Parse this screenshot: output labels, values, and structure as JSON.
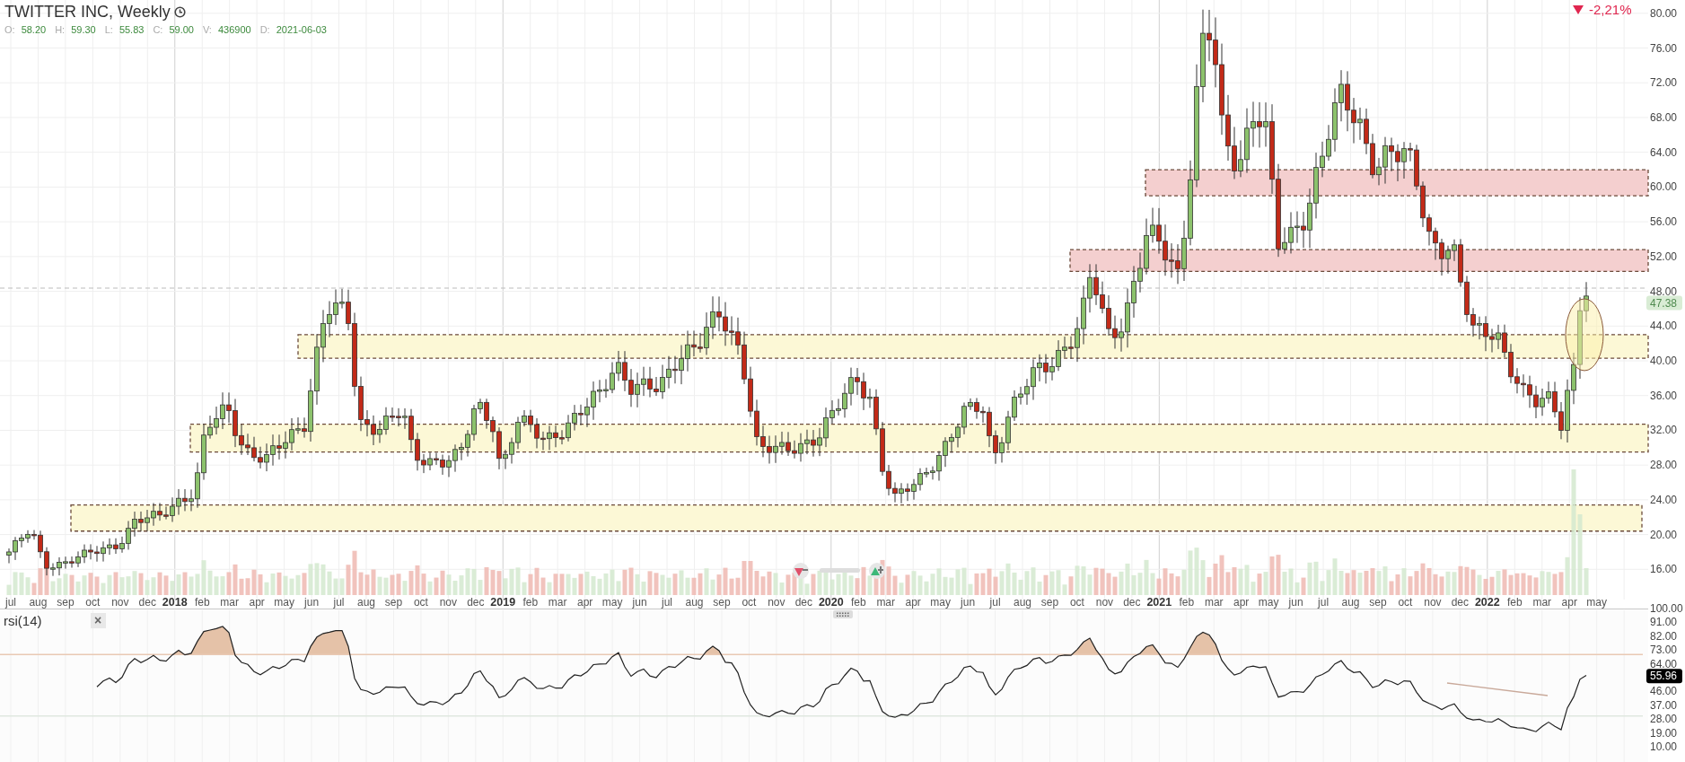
{
  "header": {
    "title": "TWITTER INC, Weekly",
    "fields": [
      {
        "label": "O:",
        "value": "58.20"
      },
      {
        "label": "H:",
        "value": "59.30"
      },
      {
        "label": "L:",
        "value": "55.83"
      },
      {
        "label": "C:",
        "value": "59.00"
      },
      {
        "label": "V:",
        "value": "436900"
      },
      {
        "label": "D:",
        "value": "2021-06-03"
      }
    ]
  },
  "change": {
    "text": "-2,21%",
    "falling": true
  },
  "price_axis": {
    "ticks": [
      "80.00",
      "76.00",
      "72.00",
      "68.00",
      "64.00",
      "60.00",
      "56.00",
      "52.00",
      "48.00",
      "44.00",
      "40.00",
      "36.00",
      "32.00",
      "28.00",
      "24.00",
      "20.00",
      "16.00"
    ],
    "last_price": "47.38"
  },
  "time_axis": {
    "labels": [
      {
        "text": "jul",
        "kind": "month"
      },
      {
        "text": "aug",
        "kind": "month"
      },
      {
        "text": "sep",
        "kind": "month"
      },
      {
        "text": "oct",
        "kind": "month"
      },
      {
        "text": "nov",
        "kind": "month"
      },
      {
        "text": "dec",
        "kind": "month"
      },
      {
        "text": "2018",
        "kind": "year"
      },
      {
        "text": "feb",
        "kind": "month"
      },
      {
        "text": "mar",
        "kind": "month"
      },
      {
        "text": "apr",
        "kind": "month"
      },
      {
        "text": "may",
        "kind": "month"
      },
      {
        "text": "jun",
        "kind": "month"
      },
      {
        "text": "jul",
        "kind": "month"
      },
      {
        "text": "aug",
        "kind": "month"
      },
      {
        "text": "sep",
        "kind": "month"
      },
      {
        "text": "oct",
        "kind": "month"
      },
      {
        "text": "nov",
        "kind": "month"
      },
      {
        "text": "dec",
        "kind": "month"
      },
      {
        "text": "2019",
        "kind": "year"
      },
      {
        "text": "feb",
        "kind": "month"
      },
      {
        "text": "mar",
        "kind": "month"
      },
      {
        "text": "apr",
        "kind": "month"
      },
      {
        "text": "may",
        "kind": "month"
      },
      {
        "text": "jun",
        "kind": "month"
      },
      {
        "text": "jul",
        "kind": "month"
      },
      {
        "text": "aug",
        "kind": "month"
      },
      {
        "text": "sep",
        "kind": "month"
      },
      {
        "text": "oct",
        "kind": "month"
      },
      {
        "text": "nov",
        "kind": "month"
      },
      {
        "text": "dec",
        "kind": "month"
      },
      {
        "text": "2020",
        "kind": "year"
      },
      {
        "text": "feb",
        "kind": "month"
      },
      {
        "text": "mar",
        "kind": "month"
      },
      {
        "text": "apr",
        "kind": "month"
      },
      {
        "text": "may",
        "kind": "month"
      },
      {
        "text": "jun",
        "kind": "month"
      },
      {
        "text": "jul",
        "kind": "month"
      },
      {
        "text": "aug",
        "kind": "month"
      },
      {
        "text": "sep",
        "kind": "month"
      },
      {
        "text": "oct",
        "kind": "month"
      },
      {
        "text": "nov",
        "kind": "month"
      },
      {
        "text": "dec",
        "kind": "month"
      },
      {
        "text": "2021",
        "kind": "year"
      },
      {
        "text": "feb",
        "kind": "month"
      },
      {
        "text": "mar",
        "kind": "month"
      },
      {
        "text": "apr",
        "kind": "month"
      },
      {
        "text": "may",
        "kind": "month"
      },
      {
        "text": "jun",
        "kind": "month"
      },
      {
        "text": "jul",
        "kind": "month"
      },
      {
        "text": "aug",
        "kind": "month"
      },
      {
        "text": "sep",
        "kind": "month"
      },
      {
        "text": "oct",
        "kind": "month"
      },
      {
        "text": "nov",
        "kind": "month"
      },
      {
        "text": "dec",
        "kind": "month"
      },
      {
        "text": "2022",
        "kind": "year"
      },
      {
        "text": "feb",
        "kind": "month"
      },
      {
        "text": "mar",
        "kind": "month"
      },
      {
        "text": "apr",
        "kind": "month"
      },
      {
        "text": "may",
        "kind": "month"
      }
    ]
  },
  "rsi": {
    "label": "rsi(14)",
    "close": "×",
    "ticks": [
      "100.00",
      "91.00",
      "82.00",
      "73.00",
      "64.00",
      "46.00",
      "37.00",
      "28.00",
      "19.00",
      "10.00"
    ],
    "reading": "55.96"
  }
}
